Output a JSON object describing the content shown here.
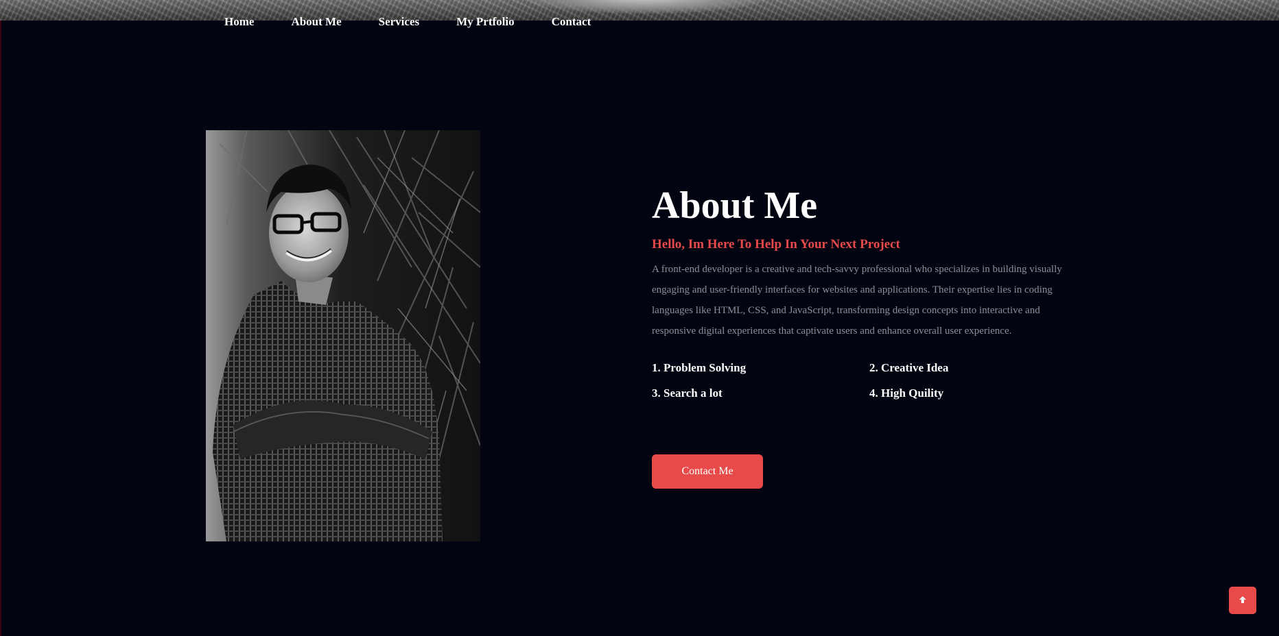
{
  "nav": {
    "items": [
      {
        "label": "Home"
      },
      {
        "label": "About Me"
      },
      {
        "label": "Services"
      },
      {
        "label": "My Prtfolio"
      },
      {
        "label": "Contact"
      }
    ]
  },
  "about": {
    "title": "About Me",
    "subtitle": "Hello, Im Here To Help In Your Next Project",
    "description": "A front-end developer is a creative and tech-savvy professional who specializes in building visually engaging and user-friendly interfaces for websites and applications. Their expertise lies in coding languages like HTML, CSS, and JavaScript, transforming design concepts into interactive and responsive digital experiences that captivate users and enhance overall user experience.",
    "skills": [
      "1. Problem Solving",
      "2. Creative Idea",
      "3. Search a lot",
      "4. High Quility"
    ],
    "button_label": "Contact Me"
  },
  "back_to_top": {
    "icon": "arrow-up-icon"
  },
  "colors": {
    "background": "#020412",
    "accent": "#e84a4a",
    "text": "#ffffff",
    "muted_text": "#8e8e96"
  }
}
